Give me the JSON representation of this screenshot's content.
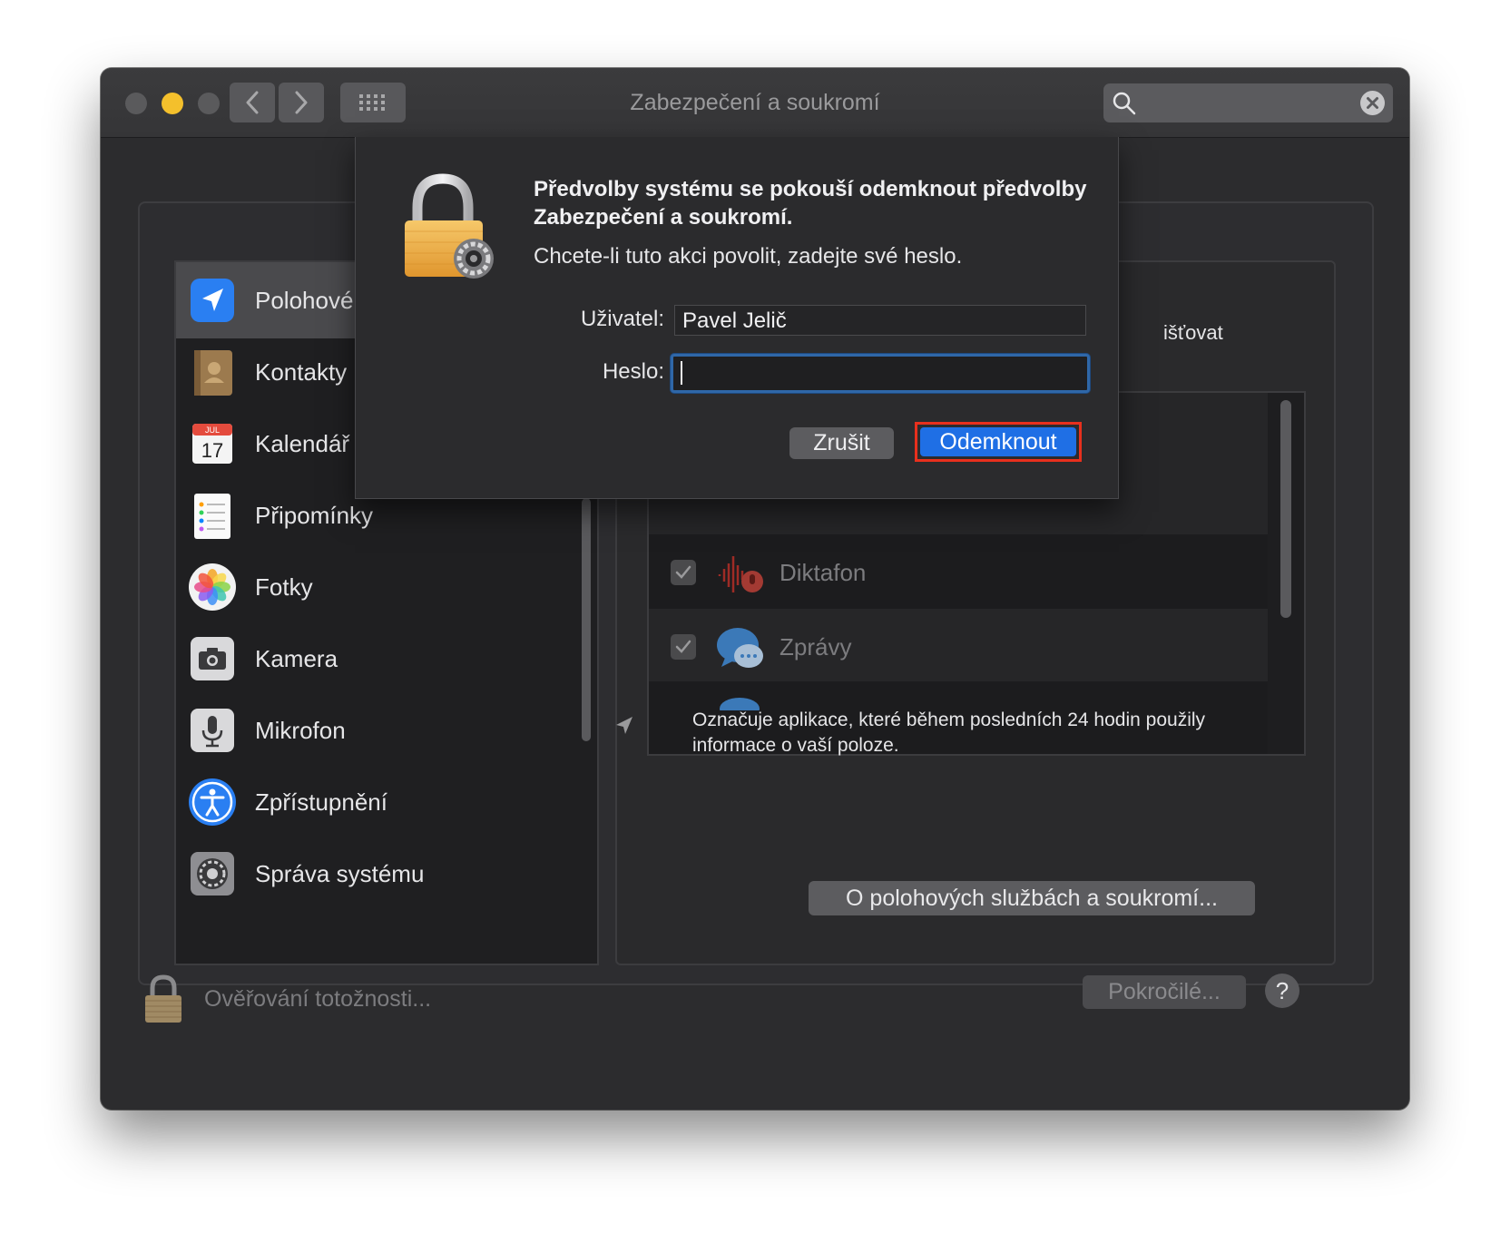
{
  "window": {
    "title": "Zabezpečení a soukromí"
  },
  "search": {
    "placeholder": ""
  },
  "sidebar": {
    "items": [
      {
        "label": "Polohové",
        "icon": "location-arrow-icon",
        "selected": true
      },
      {
        "label": "Kontakty",
        "icon": "contacts-book-icon"
      },
      {
        "label": "Kalendář",
        "icon": "calendar-icon",
        "badge_month": "JUL",
        "badge_day": "17"
      },
      {
        "label": "Připomínky",
        "icon": "reminders-icon"
      },
      {
        "label": "Fotky",
        "icon": "photos-icon"
      },
      {
        "label": "Kamera",
        "icon": "camera-icon"
      },
      {
        "label": "Mikrofon",
        "icon": "microphone-icon"
      },
      {
        "label": "Zpřístupnění",
        "icon": "accessibility-icon"
      },
      {
        "label": "Správa systému",
        "icon": "gear-icon"
      }
    ]
  },
  "main": {
    "partial_label": "išťovat",
    "apps": [
      {
        "name": "Diktafon",
        "checked": true,
        "icon": "voice-memos-icon"
      },
      {
        "name": "Zprávy",
        "checked": true,
        "icon": "messages-icon"
      }
    ],
    "note": "Označuje aplikace, které během posledních 24 hodin použily informace o vaší poloze.",
    "about_button": "O polohových službách a soukromí..."
  },
  "footer": {
    "auth_label": "Ověřování totožnosti...",
    "advanced_button": "Pokročilé...",
    "help_button": "?"
  },
  "dialog": {
    "title": "Předvolby systému se pokouší odemknout předvolby Zabezpečení a soukromí.",
    "subtitle": "Chcete-li tuto akci povolit, zadejte své heslo.",
    "user_label": "Uživatel:",
    "user_value": "Pavel Jelič",
    "password_label": "Heslo:",
    "password_value": "",
    "cancel_button": "Zrušit",
    "unlock_button": "Odemknout"
  },
  "colors": {
    "accent": "#1f6fe5",
    "highlight_border": "#e8301d",
    "focus_ring": "#2f67a8",
    "window_bg": "#2c2c2e"
  }
}
